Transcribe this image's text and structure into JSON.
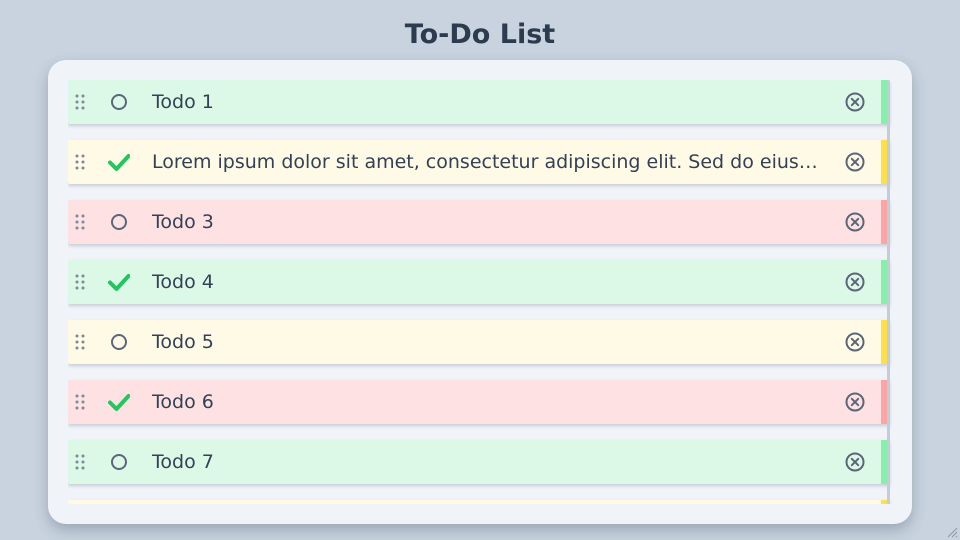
{
  "page": {
    "title": "To-Do List"
  },
  "colors": {
    "background": "#c8d3df",
    "card": "#f0f3f8",
    "title": "#2d3b4f",
    "text": "#334155",
    "check": "#22c55e",
    "priority_green_bg": "#dcf8e6",
    "priority_green_stripe": "#86efac",
    "priority_yellow_bg": "#fefae6",
    "priority_yellow_stripe": "#fde047",
    "priority_red_bg": "#fee1e2",
    "priority_red_stripe": "#fca5a5"
  },
  "todos": [
    {
      "text": "Todo 1",
      "done": false,
      "priority": "green"
    },
    {
      "text": "Lorem ipsum dolor sit amet, consectetur adipiscing elit. Sed do eiusmod tempor incididunt ut labore et dolore magna aliqua.",
      "done": true,
      "priority": "yellow"
    },
    {
      "text": "Todo 3",
      "done": false,
      "priority": "red"
    },
    {
      "text": "Todo 4",
      "done": true,
      "priority": "green"
    },
    {
      "text": "Todo 5",
      "done": false,
      "priority": "yellow"
    },
    {
      "text": "Todo 6",
      "done": true,
      "priority": "red"
    },
    {
      "text": "Todo 7",
      "done": false,
      "priority": "green"
    },
    {
      "text": "",
      "done": false,
      "priority": "yellow"
    }
  ],
  "icons": {
    "drag": "drag-handle-icon",
    "open": "circle-icon",
    "done": "checkmark-icon",
    "delete": "close-circle-icon"
  }
}
